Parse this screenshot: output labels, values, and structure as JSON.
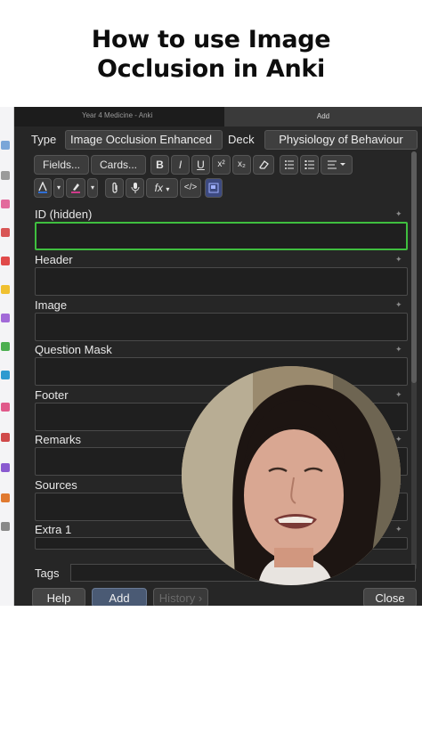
{
  "headline": {
    "line1": "How to use Image",
    "line2": "Occlusion in Anki"
  },
  "window": {
    "title_left": "Year 4 Medicine - Anki",
    "title_right": "Add"
  },
  "note": {
    "type_label": "Type",
    "type_value": "Image Occlusion Enhanced",
    "deck_label": "Deck",
    "deck_value": "Physiology of Behaviour"
  },
  "toolbar": {
    "fields_label": "Fields...",
    "cards_label": "Cards...",
    "bold": "B",
    "italic": "I",
    "underline": "U",
    "superscript": "x²",
    "subscript": "x₂",
    "function": "fx",
    "html": "</>"
  },
  "fields": [
    {
      "label": "ID (hidden)"
    },
    {
      "label": "Header"
    },
    {
      "label": "Image"
    },
    {
      "label": "Question Mask"
    },
    {
      "label": "Footer"
    },
    {
      "label": "Remarks"
    },
    {
      "label": "Sources"
    },
    {
      "label": "Extra 1"
    }
  ],
  "tags_label": "Tags",
  "buttons": {
    "help": "Help",
    "add": "Add",
    "history": "History ›",
    "close": "Close"
  },
  "colors": {
    "active_field_border": "#3fbf3f",
    "editor_background": "#262626"
  }
}
